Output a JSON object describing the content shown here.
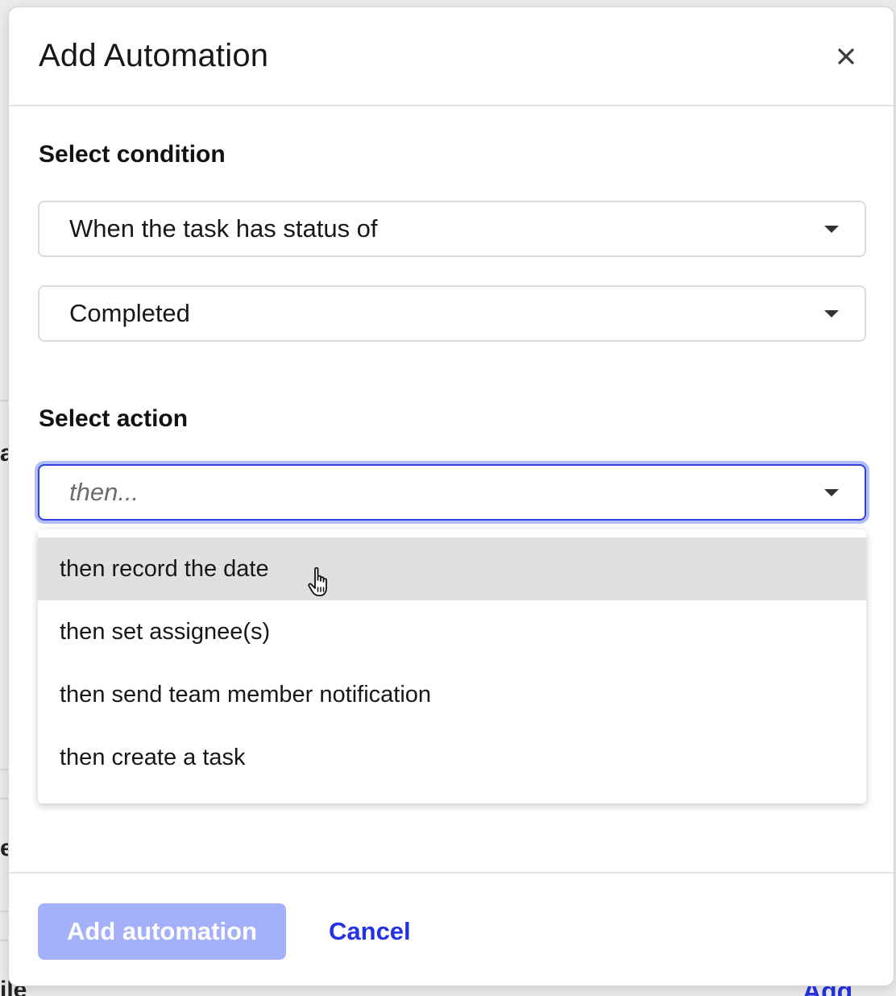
{
  "background": {
    "fragment_1": "a",
    "fragment_2": "e",
    "fragment_3": "ile",
    "link": "Add file"
  },
  "modal": {
    "title": "Add Automation",
    "close_icon": "close-icon",
    "condition": {
      "label": "Select condition",
      "trigger_value": "When the task has status of",
      "status_value": "Completed"
    },
    "action": {
      "label": "Select action",
      "placeholder": "then...",
      "options": [
        "then record the date",
        "then set assignee(s)",
        "then send team member notification",
        "then create a task"
      ],
      "hovered_index": 0
    },
    "footer": {
      "primary_label": "Add automation",
      "cancel_label": "Cancel"
    }
  },
  "colors": {
    "accent": "#2433e0",
    "primary_disabled": "#a4b0fa",
    "focus_ring": "#b3bdf7",
    "hover_bg": "#e0e0e3"
  }
}
